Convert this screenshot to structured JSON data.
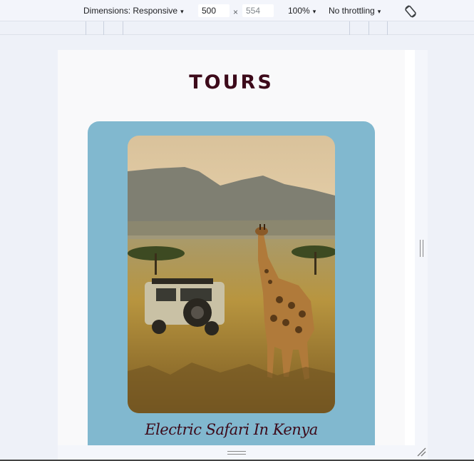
{
  "devtools": {
    "dimensions_label": "Dimensions: Responsive",
    "width_value": "500",
    "times_symbol": "×",
    "height_value": "554",
    "zoom_label": "100%",
    "throttling_label": "No throttling",
    "caret": "▾",
    "rotate_icon": "rotate-icon"
  },
  "page": {
    "title": "TOURS",
    "card": {
      "image_subject": "giraffe-safari-photo",
      "caption": "Electric Safari In Kenya"
    }
  },
  "colors": {
    "card_background": "#81b8cf",
    "title_color": "#3d0a1a",
    "viewport_background": "#f9f9fa"
  }
}
